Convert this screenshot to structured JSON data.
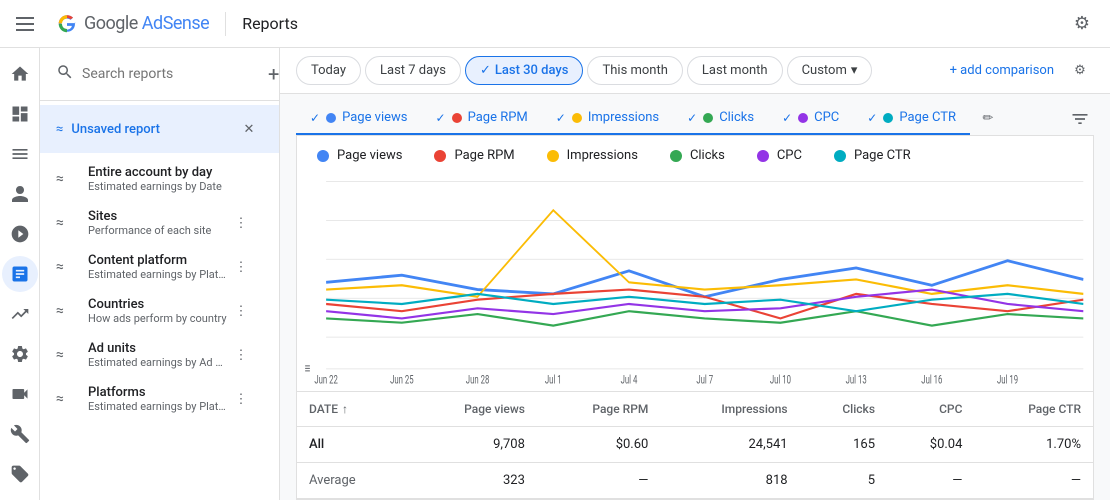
{
  "topbar": {
    "menu_icon_label": "menu",
    "brand_google": "Google ",
    "brand_adsense": "AdSense",
    "divider": true,
    "page_title": "Reports",
    "gear_icon": "⚙"
  },
  "leftnav": {
    "icons": [
      {
        "id": "home",
        "symbol": "🏠",
        "active": false
      },
      {
        "id": "dashboard",
        "symbol": "⊞",
        "active": false
      },
      {
        "id": "content",
        "symbol": "☰",
        "active": false
      },
      {
        "id": "person",
        "symbol": "👤",
        "active": false
      },
      {
        "id": "block",
        "symbol": "⊘",
        "active": false
      },
      {
        "id": "chart",
        "symbol": "📊",
        "active": true
      },
      {
        "id": "trending",
        "symbol": "📈",
        "active": false
      },
      {
        "id": "settings",
        "symbol": "⚙",
        "active": false
      },
      {
        "id": "video",
        "symbol": "▶",
        "active": false
      },
      {
        "id": "wrench",
        "symbol": "🔧",
        "active": false
      },
      {
        "id": "tag",
        "symbol": "🏷",
        "active": false
      }
    ]
  },
  "sidebar": {
    "search_placeholder": "Search reports",
    "add_icon": "+",
    "unsaved_report": {
      "title": "Unsaved report",
      "close_icon": "✕"
    },
    "items": [
      {
        "id": "entire-account",
        "icon": "≈",
        "title": "Entire account by day",
        "subtitle": "Estimated earnings by Date",
        "has_more": false
      },
      {
        "id": "sites",
        "icon": "≈",
        "title": "Sites",
        "subtitle": "Performance of each site",
        "has_more": true
      },
      {
        "id": "content-platform",
        "icon": "≈",
        "title": "Content platform",
        "subtitle": "Estimated earnings by Platform...",
        "has_more": true
      },
      {
        "id": "countries",
        "icon": "≈",
        "title": "Countries",
        "subtitle": "How ads perform by country",
        "has_more": true
      },
      {
        "id": "ad-units",
        "icon": "≈",
        "title": "Ad units",
        "subtitle": "Estimated earnings by Ad unit",
        "has_more": true
      },
      {
        "id": "platforms",
        "icon": "≈",
        "title": "Platforms",
        "subtitle": "Estimated earnings by Platform",
        "has_more": true
      }
    ]
  },
  "filterbar": {
    "buttons": [
      {
        "id": "today",
        "label": "Today",
        "active": false
      },
      {
        "id": "last7",
        "label": "Last 7 days",
        "active": false
      },
      {
        "id": "last30",
        "label": "Last 30 days",
        "active": true
      },
      {
        "id": "thismonth",
        "label": "This month",
        "active": false
      },
      {
        "id": "lastmonth",
        "label": "Last month",
        "active": false
      },
      {
        "id": "custom",
        "label": "Custom",
        "active": false,
        "has_dropdown": true
      }
    ],
    "add_comparison": "+ add comparison",
    "gear_icon": "⚙"
  },
  "metrics": {
    "tabs": [
      {
        "id": "pageviews",
        "label": "Page views",
        "active": true,
        "color": "#4285F4"
      },
      {
        "id": "pagerpm",
        "label": "Page RPM",
        "active": true,
        "color": "#EA4335"
      },
      {
        "id": "impressions",
        "label": "Impressions",
        "active": true,
        "color": "#FBBC05"
      },
      {
        "id": "clicks",
        "label": "Clicks",
        "active": true,
        "color": "#34A853"
      },
      {
        "id": "cpc",
        "label": "CPC",
        "active": true,
        "color": "#9334E6"
      },
      {
        "id": "pagectr",
        "label": "Page CTR",
        "active": true,
        "color": "#00ACC1"
      }
    ],
    "edit_icon": "✏",
    "filter_icon": "⊟"
  },
  "chart": {
    "legend": [
      {
        "label": "Page views",
        "color": "#4285F4"
      },
      {
        "label": "Page RPM",
        "color": "#EA4335"
      },
      {
        "label": "Impressions",
        "color": "#FBBC05"
      },
      {
        "label": "Clicks",
        "color": "#34A853"
      },
      {
        "label": "CPC",
        "color": "#9334E6"
      },
      {
        "label": "Page CTR",
        "color": "#00ACC1"
      }
    ],
    "x_labels": [
      "Jun 22",
      "Jun 25",
      "Jun 28",
      "Jul 1",
      "Jul 4",
      "Jul 7",
      "Jul 10",
      "Jul 13",
      "Jul 16",
      "Jul 19"
    ],
    "grid_lines": 5
  },
  "table": {
    "columns": [
      {
        "id": "date",
        "label": "DATE",
        "sortable": true
      },
      {
        "id": "pageviews",
        "label": "Page views"
      },
      {
        "id": "pagerpm",
        "label": "Page RPM"
      },
      {
        "id": "impressions",
        "label": "Impressions"
      },
      {
        "id": "clicks",
        "label": "Clicks"
      },
      {
        "id": "cpc",
        "label": "CPC"
      },
      {
        "id": "pagectr",
        "label": "Page CTR"
      }
    ],
    "rows": [
      {
        "date": "All",
        "pageviews": "9,708",
        "pagerpm": "$0.60",
        "impressions": "24,541",
        "clicks": "165",
        "cpc": "$0.04",
        "pagectr": "1.70%"
      },
      {
        "date": "Average",
        "pageviews": "323",
        "pagerpm": "—",
        "impressions": "818",
        "clicks": "5",
        "cpc": "—",
        "pagectr": "—"
      }
    ]
  }
}
